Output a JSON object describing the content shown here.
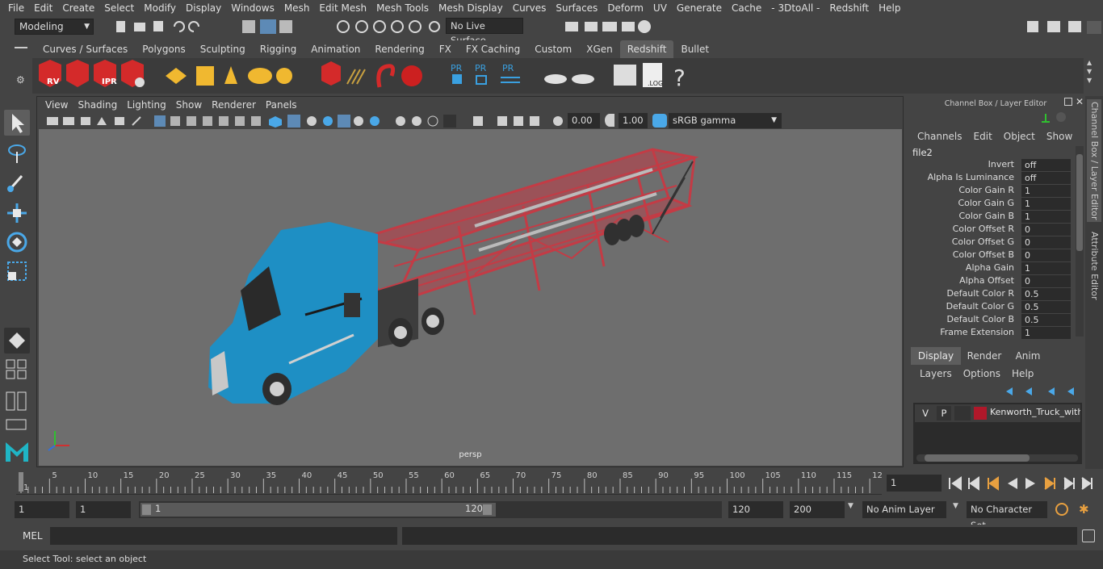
{
  "menu": [
    "File",
    "Edit",
    "Create",
    "Select",
    "Modify",
    "Display",
    "Windows",
    "Mesh",
    "Edit Mesh",
    "Mesh Tools",
    "Mesh Display",
    "Curves",
    "Surfaces",
    "Deform",
    "UV",
    "Generate",
    "Cache",
    "- 3DtoAll -",
    "Redshift",
    "Help"
  ],
  "status": {
    "mode": "Modeling",
    "live_surface": "No Live Surface"
  },
  "shelf_tabs": [
    "Curves / Surfaces",
    "Polygons",
    "Sculpting",
    "Rigging",
    "Animation",
    "Rendering",
    "FX",
    "FX Caching",
    "Custom",
    "XGen",
    "Redshift",
    "Bullet"
  ],
  "shelf_active": "Redshift",
  "shelf_icons": {
    "rv": "RV",
    "ipr": "IPR",
    "pr": "PR",
    "log": ".LOG",
    "help": "?"
  },
  "panel_menu": [
    "View",
    "Shading",
    "Lighting",
    "Show",
    "Renderer",
    "Panels"
  ],
  "panel_toolbar": {
    "exposure": "0.00",
    "gamma": "1.00",
    "colorspace": "sRGB gamma"
  },
  "viewport": {
    "camera_label": "persp"
  },
  "channel_box": {
    "title": "Channel Box / Layer Editor",
    "menu": [
      "Channels",
      "Edit",
      "Object",
      "Show"
    ],
    "node": "file2",
    "attributes": [
      {
        "name": "Invert",
        "value": "off"
      },
      {
        "name": "Alpha Is Luminance",
        "value": "off"
      },
      {
        "name": "Color Gain R",
        "value": "1"
      },
      {
        "name": "Color Gain G",
        "value": "1"
      },
      {
        "name": "Color Gain B",
        "value": "1"
      },
      {
        "name": "Color Offset R",
        "value": "0"
      },
      {
        "name": "Color Offset G",
        "value": "0"
      },
      {
        "name": "Color Offset B",
        "value": "0"
      },
      {
        "name": "Alpha Gain",
        "value": "1"
      },
      {
        "name": "Alpha Offset",
        "value": "0"
      },
      {
        "name": "Default Color R",
        "value": "0.5"
      },
      {
        "name": "Default Color G",
        "value": "0.5"
      },
      {
        "name": "Default Color B",
        "value": "0.5"
      },
      {
        "name": "Frame Extension",
        "value": "1"
      }
    ],
    "layer_tabs": [
      "Display",
      "Render",
      "Anim"
    ],
    "layer_menu": [
      "Layers",
      "Options",
      "Help"
    ],
    "layer": {
      "v": "V",
      "p": "P",
      "name": "Kenworth_Truck_with_",
      "color": "#b0182a"
    }
  },
  "side_tabs": [
    "Channel Box / Layer Editor",
    "Attribute Editor"
  ],
  "timeline": {
    "ticks": [
      "1",
      "5",
      "10",
      "15",
      "20",
      "25",
      "30",
      "35",
      "40",
      "45",
      "50",
      "55",
      "60",
      "65",
      "70",
      "75",
      "80",
      "85",
      "90",
      "95",
      "100",
      "105",
      "110",
      "115",
      "12"
    ],
    "current_frame": "1"
  },
  "range": {
    "start": "1",
    "current": "1",
    "range_start": "1",
    "range_end": "120",
    "end": "120",
    "max": "200",
    "anim_layer": "No Anim Layer",
    "char_set": "No Character Set"
  },
  "cmd": {
    "label": "MEL"
  },
  "help_text": "Select Tool: select an object"
}
